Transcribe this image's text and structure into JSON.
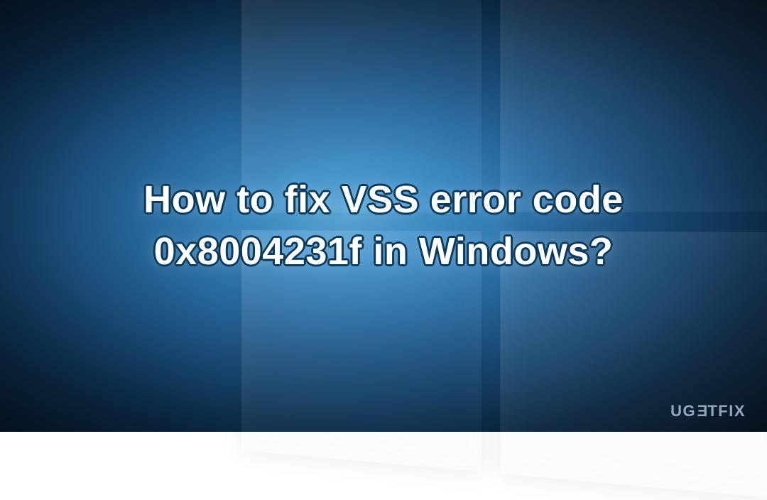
{
  "title": {
    "line1": "How to fix VSS error code",
    "line2": "0x8004231f in Windows?"
  },
  "watermark": {
    "prefix": "UG",
    "special": "E",
    "suffix": "TFIX"
  }
}
